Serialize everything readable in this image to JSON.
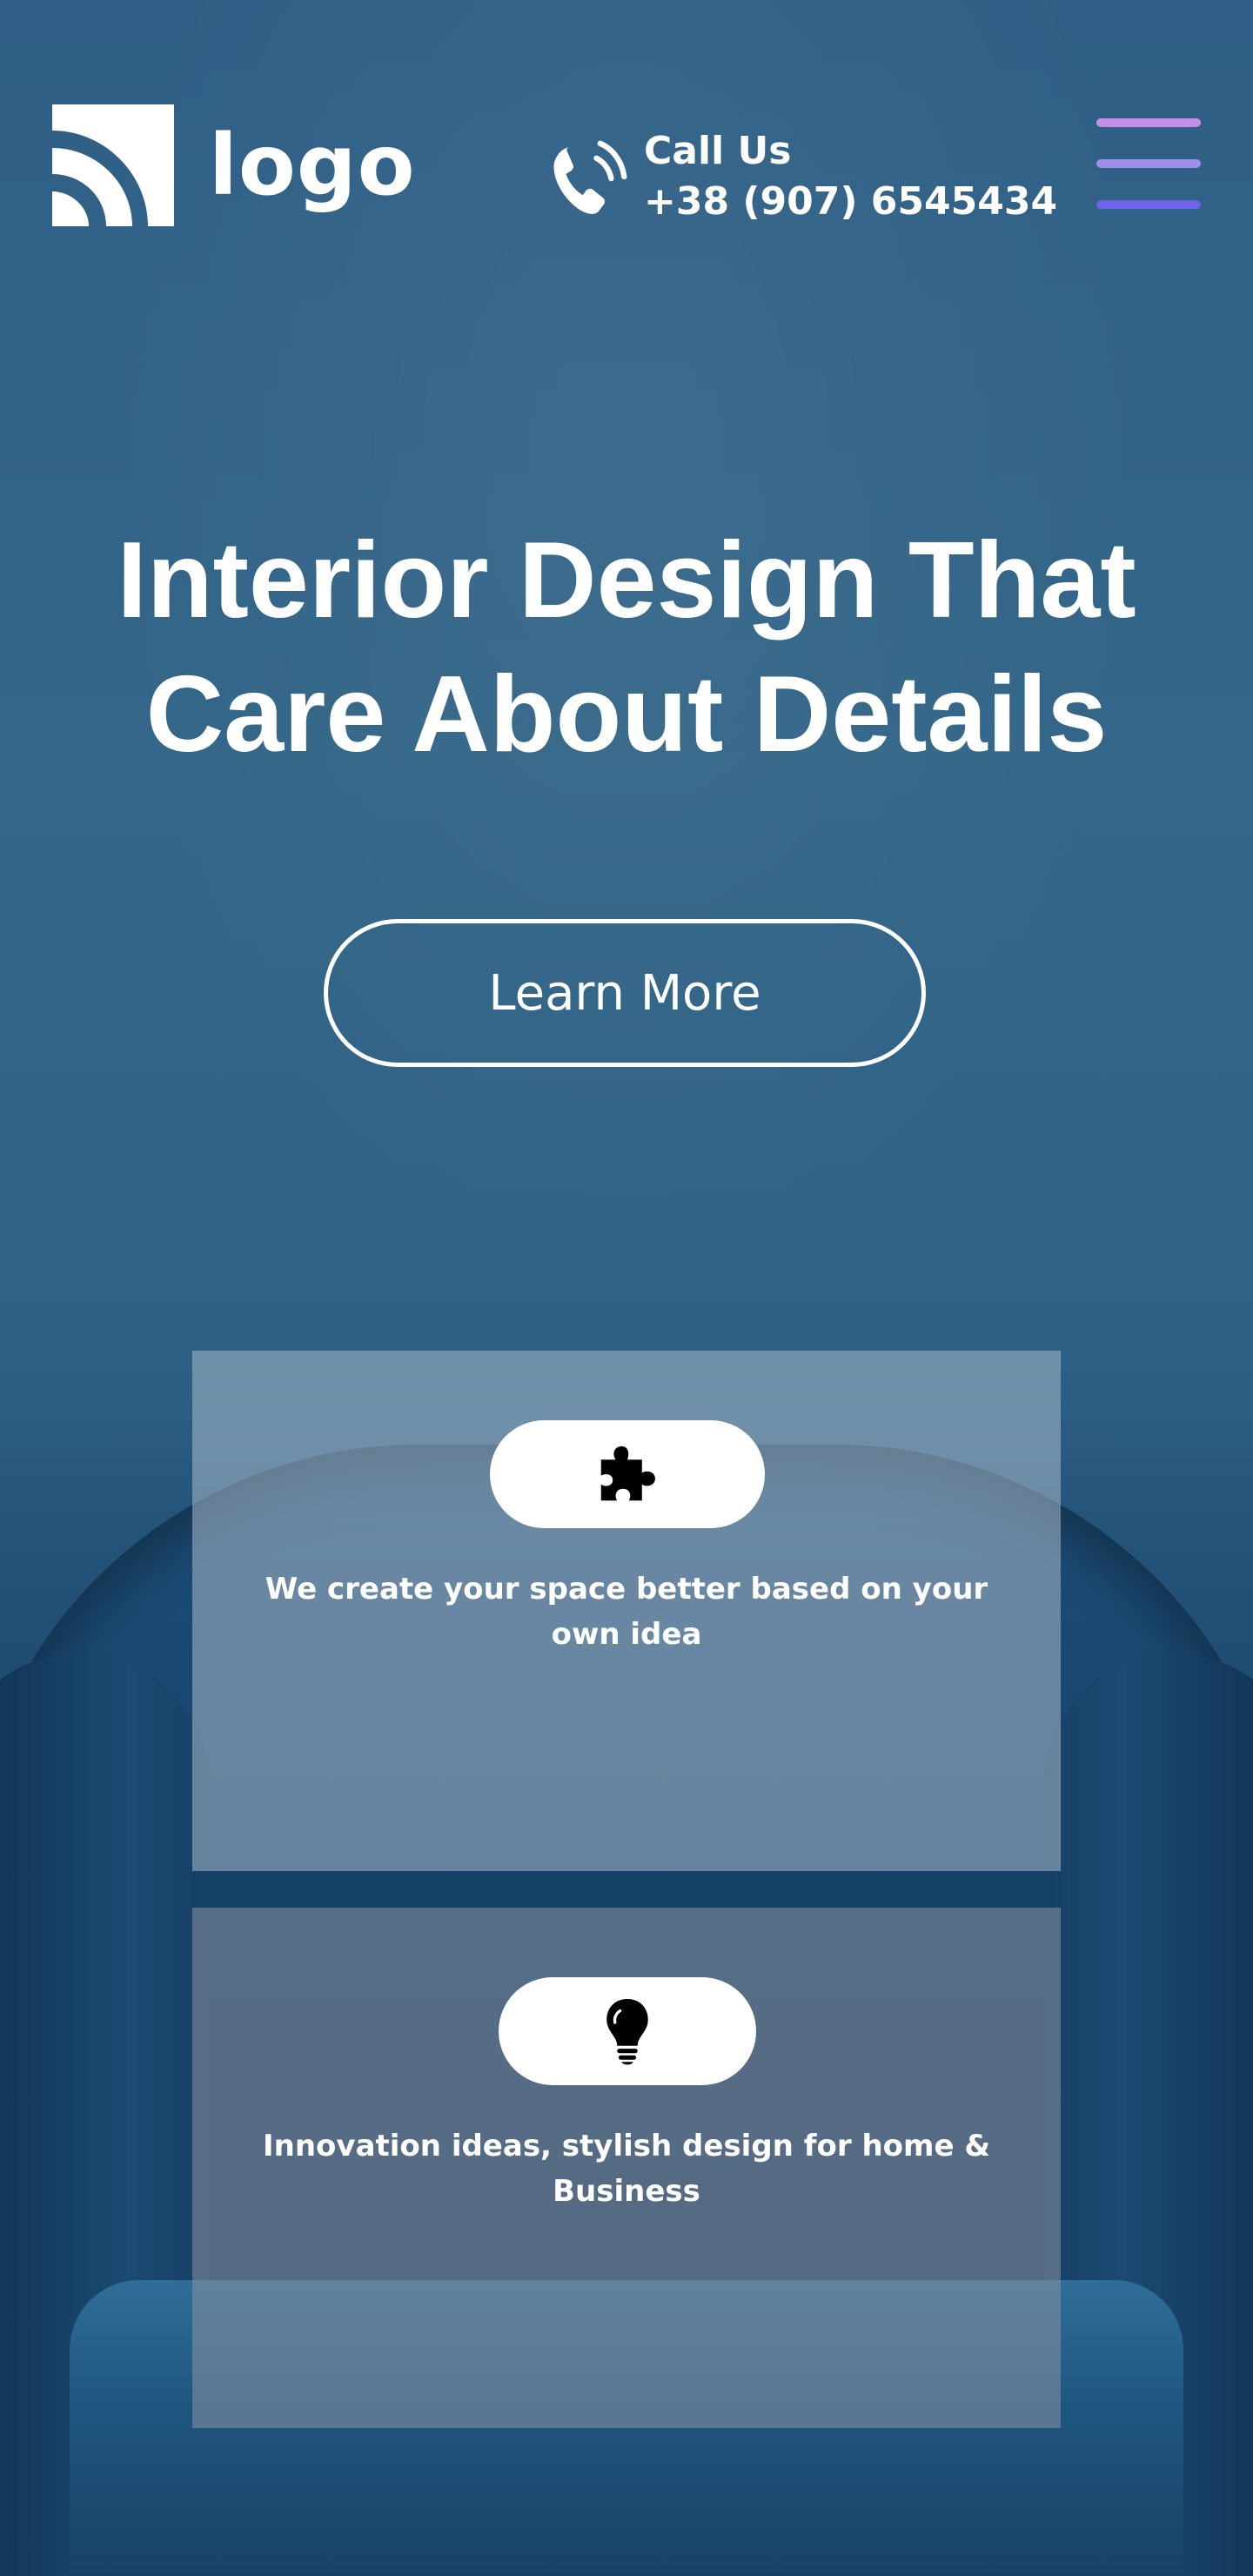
{
  "header": {
    "logo_text": "logo",
    "call_label": "Call Us",
    "call_number": "+38 (907) 6545434",
    "menu_icon": "hamburger-menu-icon",
    "phone_icon": "phone-icon"
  },
  "hero": {
    "title_line1": "Interior Design That",
    "title_line2": "Care About Details",
    "cta_label": "Learn More"
  },
  "features": [
    {
      "icon": "puzzle-icon",
      "text": "We create your space better based on your own idea"
    },
    {
      "icon": "lightbulb-icon",
      "text": "Innovation ideas, stylish design for home & Business"
    }
  ],
  "colors": {
    "background": "#2f6186",
    "menu_top": "#c58ee6",
    "menu_bottom": "#6f63ec",
    "text": "#ffffff"
  }
}
